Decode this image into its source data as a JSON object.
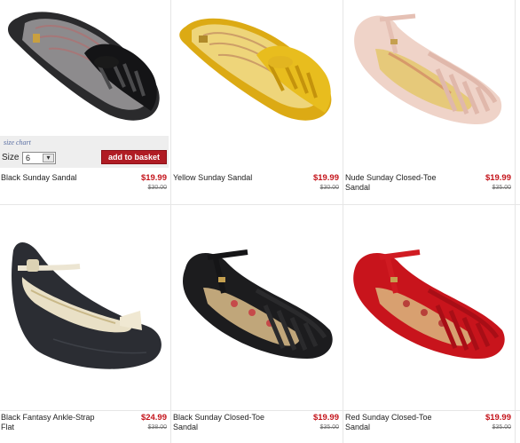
{
  "products": [
    {
      "name": "Black Sunday Sandal",
      "price": "$19.99",
      "old_price": "$30.00"
    },
    {
      "name": "Yellow Sunday Sandal",
      "price": "$19.99",
      "old_price": "$30.00"
    },
    {
      "name": "Nude Sunday Closed-Toe Sandal",
      "price": "$19.99",
      "old_price": "$35.00"
    },
    {
      "name": "Black Fantasy Ankle-Strap Flat",
      "price": "$24.99",
      "old_price": "$38.00"
    },
    {
      "name": "Black Sunday Closed-Toe Sandal",
      "price": "$19.99",
      "old_price": "$35.00"
    },
    {
      "name": "Red Sunday Closed-Toe Sandal",
      "price": "$19.99",
      "old_price": "$35.00"
    }
  ],
  "basket_panel": {
    "size_chart_link": "size chart",
    "size_label": "Size",
    "size_value": "6",
    "add_to_basket": "add to basket"
  },
  "colors": {
    "price_red": "#c4141b",
    "basket_button": "#b01c24",
    "black_sandal": "#1c1c1e",
    "yellow_sandal": "#e2b21c",
    "nude_sandal": "#f2d6cc",
    "red_sandal": "#c8141c"
  },
  "icons": {
    "select_arrow": "chevron-down-icon"
  }
}
